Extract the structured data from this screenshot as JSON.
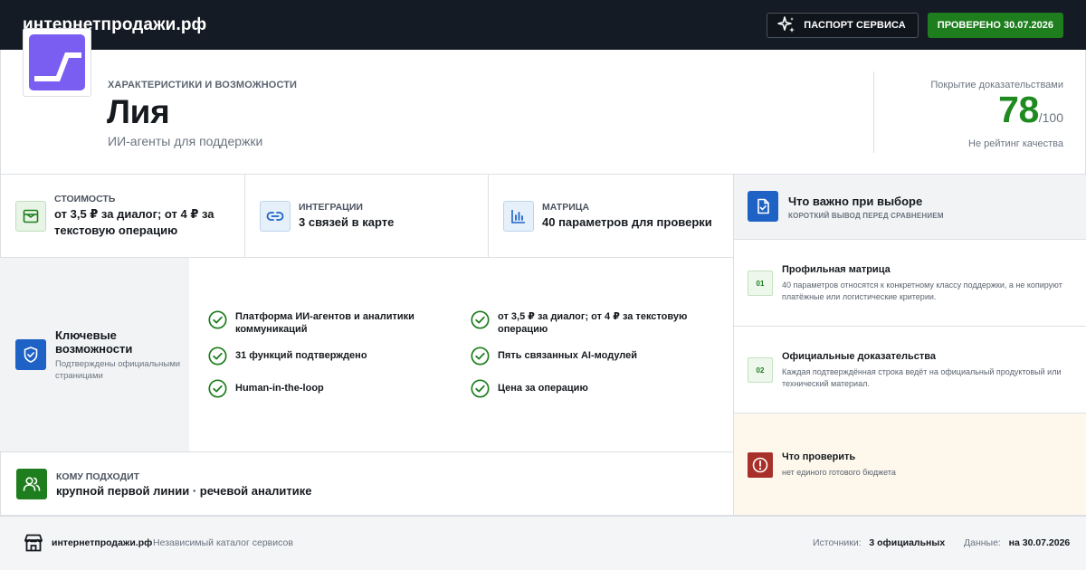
{
  "header": {
    "brand": "интернетпродажи.рф",
    "passport_label": "ПАСПОРТ СЕРВИСА",
    "verified_label": "ПРОВЕРЕНО 30.07.2026"
  },
  "hero": {
    "kicker": "ХАРАКТЕРИСТИКИ И ВОЗМОЖНОСТИ",
    "title": "Лия",
    "subtitle": "ИИ-агенты для поддержки",
    "score_label": "Покрытие доказательствами",
    "score_value": "78",
    "score_max": "/100",
    "score_note": "Не рейтинг качества"
  },
  "stats": [
    {
      "kicker": "СТОИМОСТЬ",
      "value": "от 3,5 ₽ за диалог; от 4 ₽ за текстовую операцию",
      "icon": "wallet-icon"
    },
    {
      "kicker": "ИНТЕГРАЦИИ",
      "value": "3 связей в карте",
      "icon": "link-icon"
    },
    {
      "kicker": "МАТРИЦА",
      "value": "40 параметров для проверки",
      "icon": "chart-icon"
    }
  ],
  "key_features": {
    "title": "Ключевые возможности",
    "subtitle": "Подтверждены официальными страницами",
    "items": [
      "Платформа ИИ-агентов и аналитики коммуникаций",
      "от 3,5 ₽ за диалог; от 4 ₽ за текстовую операцию",
      "31 функций подтверждено",
      "Пять связанных AI-модулей",
      "Human-in-the-loop",
      "Цена за операцию"
    ]
  },
  "audience": {
    "kicker": "КОМУ ПОДХОДИТ",
    "value": "крупной первой линии · речевой аналитике"
  },
  "right_panel": {
    "title": "Что важно при выборе",
    "subtitle": "КОРОТКИЙ ВЫВОД ПЕРЕД СРАВНЕНИЕМ",
    "cards": [
      {
        "num": "01",
        "title": "Профильная матрица",
        "text": "40 параметров относятся к конкретному классу поддержки, а не копируют платёжные или логистические критерии."
      },
      {
        "num": "02",
        "title": "Официальные доказательства",
        "text": "Каждая подтверждённая строка ведёт на официальный продуктовый или технический материал."
      }
    ],
    "warning": {
      "title": "Что проверить",
      "text": "нет единого готового бюджета"
    }
  },
  "footer": {
    "brand": "интернетпродажи.рф",
    "tagline": "Независимый каталог сервисов",
    "sources_label": "Источники:",
    "sources_value": "3 официальных",
    "date_label": "Данные:",
    "date_value": "на 30.07.2026"
  },
  "colors": {
    "header_bg": "#151b24",
    "accent_green": "#1e7e1e",
    "accent_blue": "#1f62c6",
    "logo_purple": "#7a5ef2",
    "warning_red": "#a8302a"
  }
}
